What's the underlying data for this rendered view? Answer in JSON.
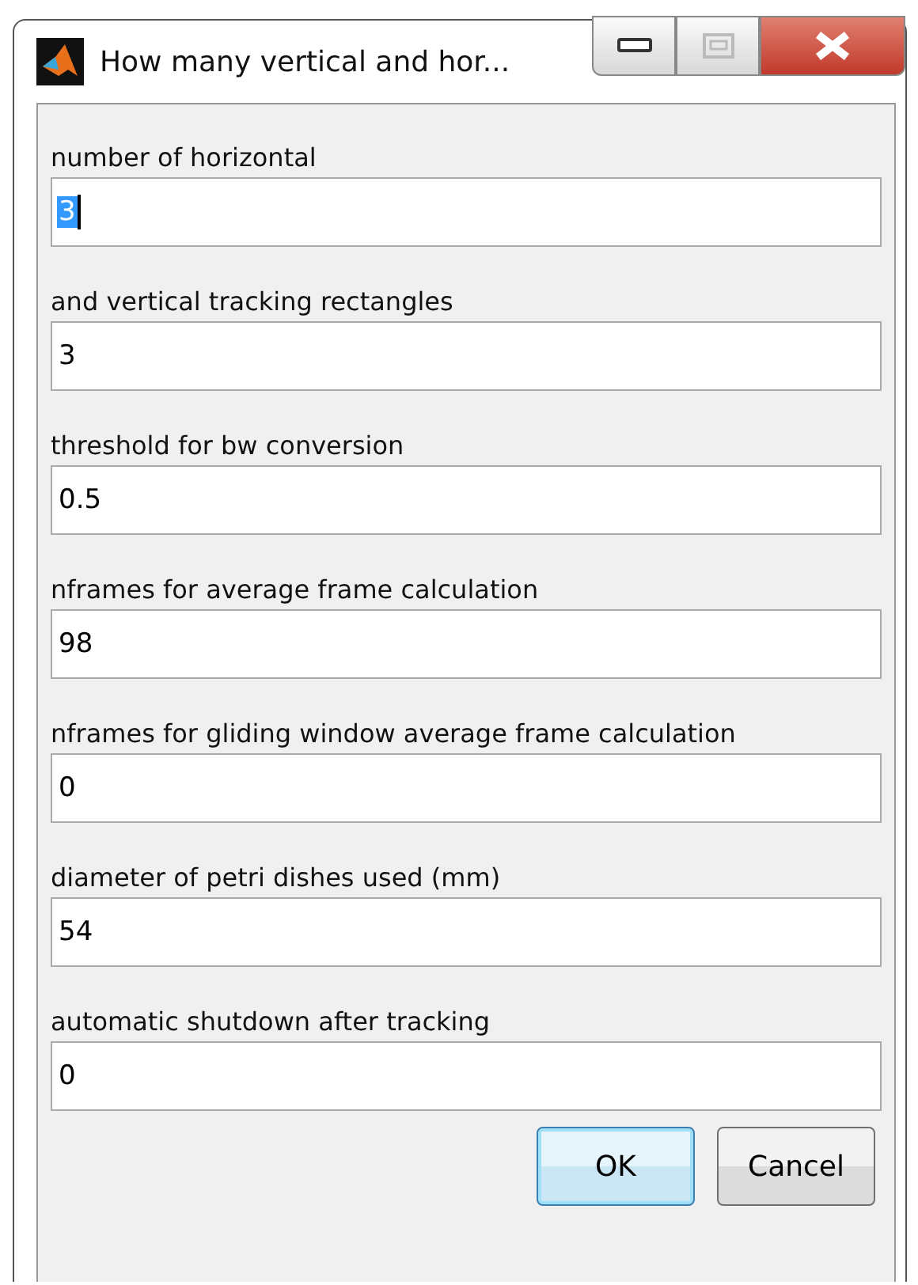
{
  "window": {
    "title": "How many vertical and hor..."
  },
  "fields": [
    {
      "label": "number of horizontal",
      "value": "3",
      "selected": true
    },
    {
      "label": "and vertical tracking rectangles",
      "value": "3",
      "selected": false
    },
    {
      "label": "threshold for bw conversion",
      "value": "0.5",
      "selected": false
    },
    {
      "label": "nframes for average frame calculation",
      "value": "98",
      "selected": false
    },
    {
      "label": "nframes for gliding window average frame calculation",
      "value": "0",
      "selected": false
    },
    {
      "label": "diameter of petri dishes used (mm)",
      "value": "54",
      "selected": false
    },
    {
      "label": "automatic shutdown after tracking",
      "value": "0",
      "selected": false
    }
  ],
  "buttons": [
    {
      "label": "OK",
      "default": true
    },
    {
      "label": "Cancel",
      "default": false
    }
  ]
}
